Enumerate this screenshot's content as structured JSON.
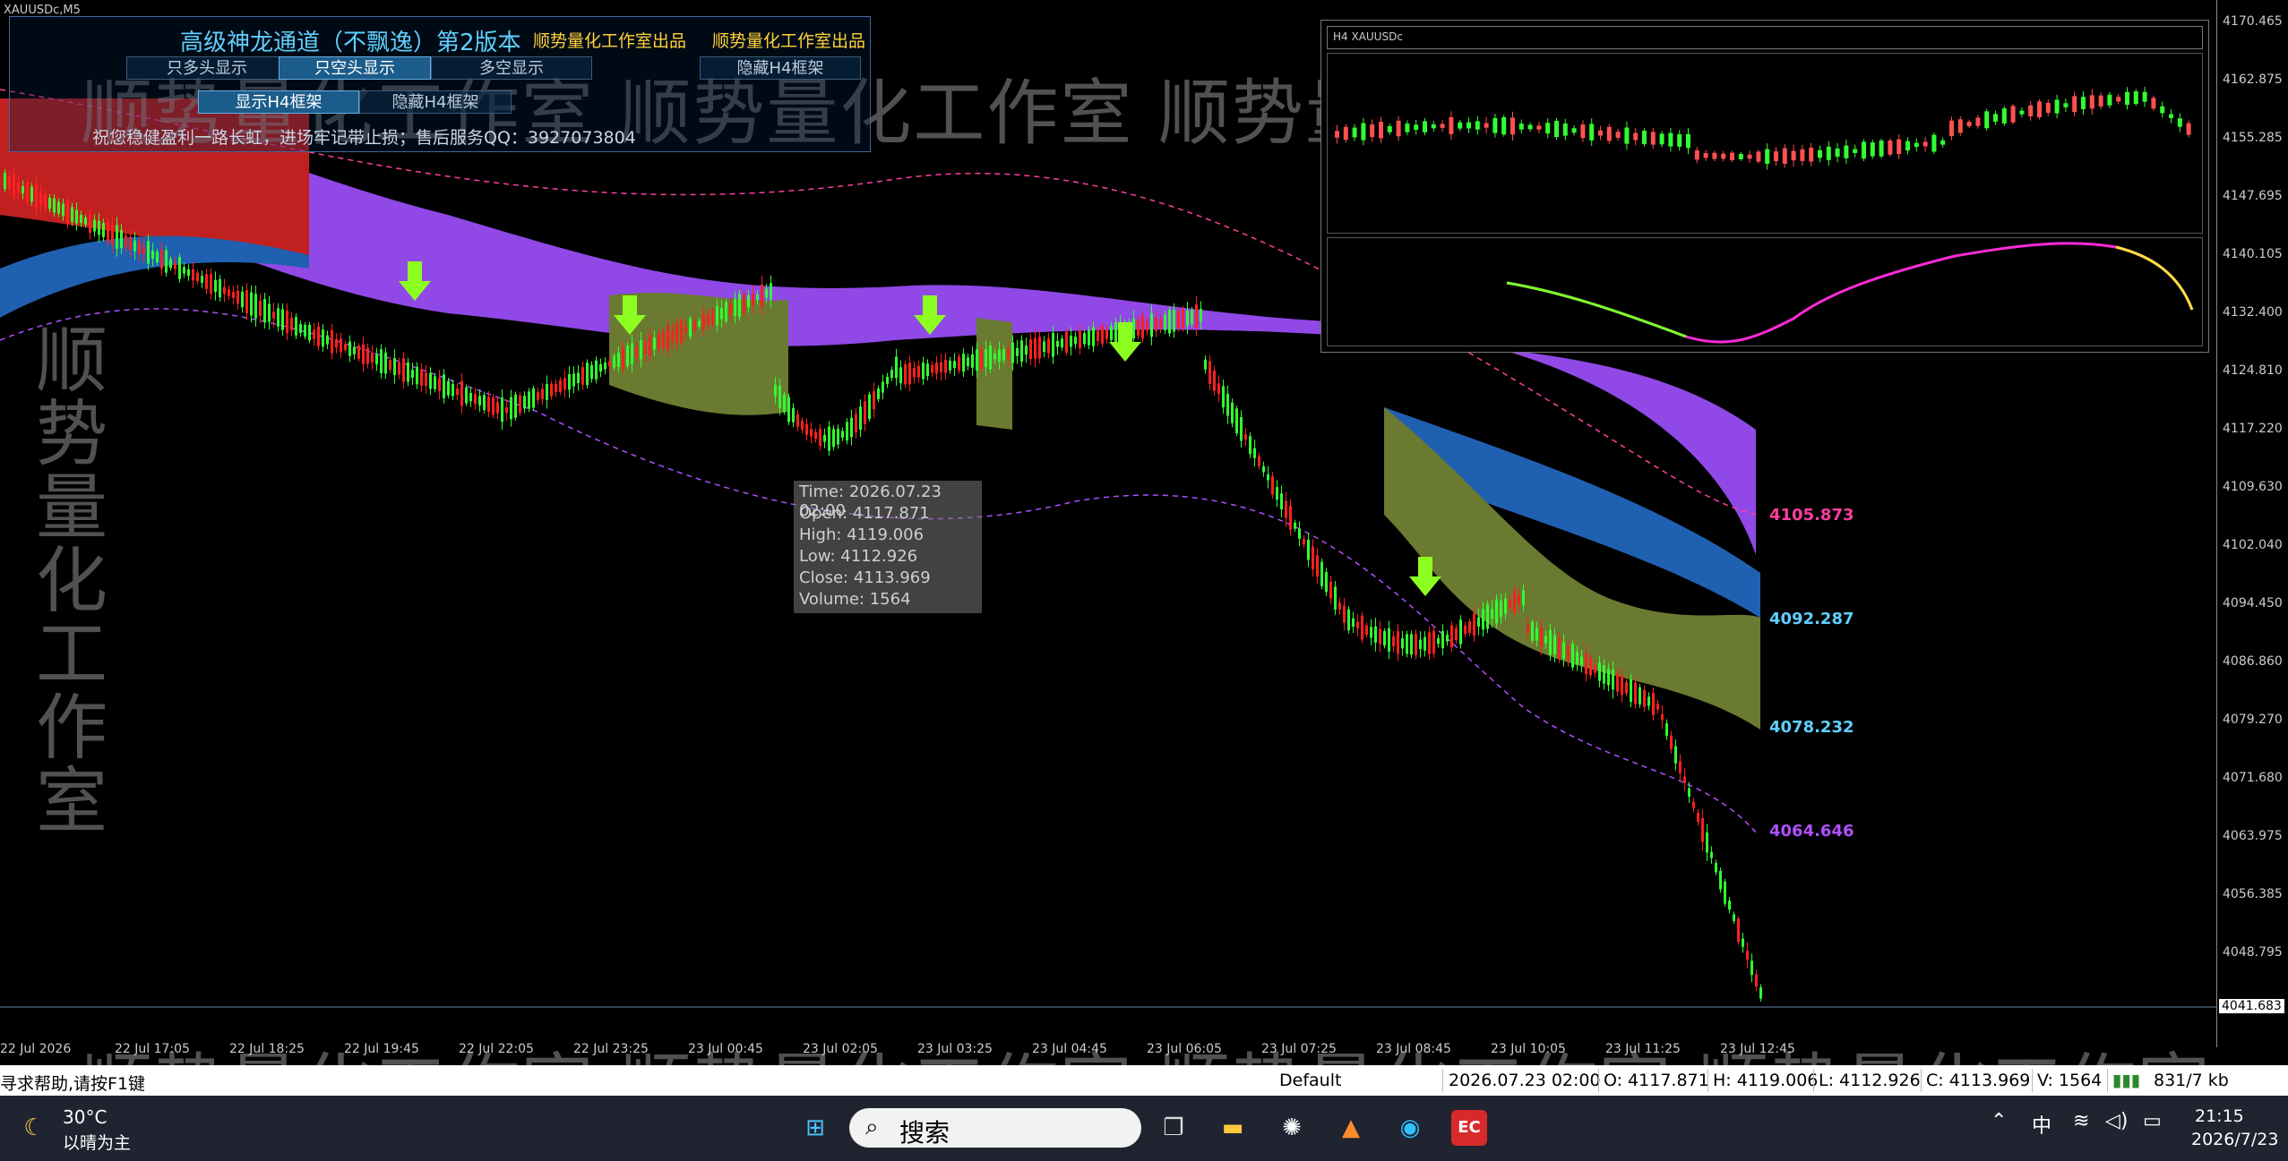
{
  "chart": {
    "symbol": "XAUUSDc,M5",
    "price_ticks": [
      "4170.465",
      "4162.875",
      "4155.285",
      "4147.695",
      "4140.105",
      "4132.400",
      "4124.810",
      "4117.220",
      "4109.630",
      "4102.040",
      "4094.450",
      "4086.860",
      "4079.270",
      "4071.680",
      "4063.975",
      "4056.385",
      "4048.795"
    ],
    "current_price": "4041.683",
    "time_ticks": [
      "22 Jul 2026",
      "22 Jul 17:05",
      "22 Jul 18:25",
      "22 Jul 19:45",
      "22 Jul 22:05",
      "22 Jul 23:25",
      "23 Jul 00:45",
      "23 Jul 02:05",
      "23 Jul 03:25",
      "23 Jul 04:45",
      "23 Jul 06:05",
      "23 Jul 07:25",
      "23 Jul 08:45",
      "23 Jul 10:05",
      "23 Jul 11:25",
      "23 Jul 12:45"
    ],
    "levels": [
      {
        "value": "4105.873",
        "color": "#ff3fa0"
      },
      {
        "value": "4092.287",
        "color": "#5fd0ff"
      },
      {
        "value": "4078.232",
        "color": "#5fd0ff"
      },
      {
        "value": "4064.646",
        "color": "#b050ff"
      }
    ]
  },
  "panel": {
    "title": "高级神龙通道（不飘逸）第2版本",
    "brand_1": "顺势量化工作室出品",
    "brand_2": "顺势量化工作室出品",
    "btn_long_only": "只多头显示",
    "btn_short_only": "只空头显示",
    "btn_multi_short": "多空显示",
    "btn_hide_h4": "隐藏H4框架",
    "btn_show_h4": "显示H4框架",
    "btn_hide_h4_2": "隐藏H4框架",
    "message": "祝您稳健盈利一路长虹，进场牢记带止损；售后服务QQ：3927073804"
  },
  "watermark": "顺势量化工作室 顺势量化工作室 顺势量化工作室 顺势量化工作室",
  "watermark_v": "顺势量化工作室",
  "tooltip": {
    "time": "Time: 2026.07.23 02:00",
    "open": "Open: 4117.871",
    "high": "High: 4119.006",
    "low": "Low:  4112.926",
    "close": "Close: 4113.969",
    "volume": "Volume: 1564"
  },
  "inset": {
    "title": "H4  XAUUSDc"
  },
  "status": {
    "help": "寻求帮助,请按F1键",
    "profile": "Default",
    "datetime": "2026.07.23 02:00",
    "open": "O: 4117.871",
    "high": "H: 4119.006",
    "low": "L: 4112.926",
    "close": "C: 4113.969",
    "volume": "V: 1564",
    "traffic": "831/7 kb"
  },
  "taskbar": {
    "weather_temp": "30°C",
    "weather_desc": "以晴为主",
    "search_placeholder": "搜索",
    "ime": "中",
    "time": "21:15",
    "date": "2026/7/23"
  }
}
